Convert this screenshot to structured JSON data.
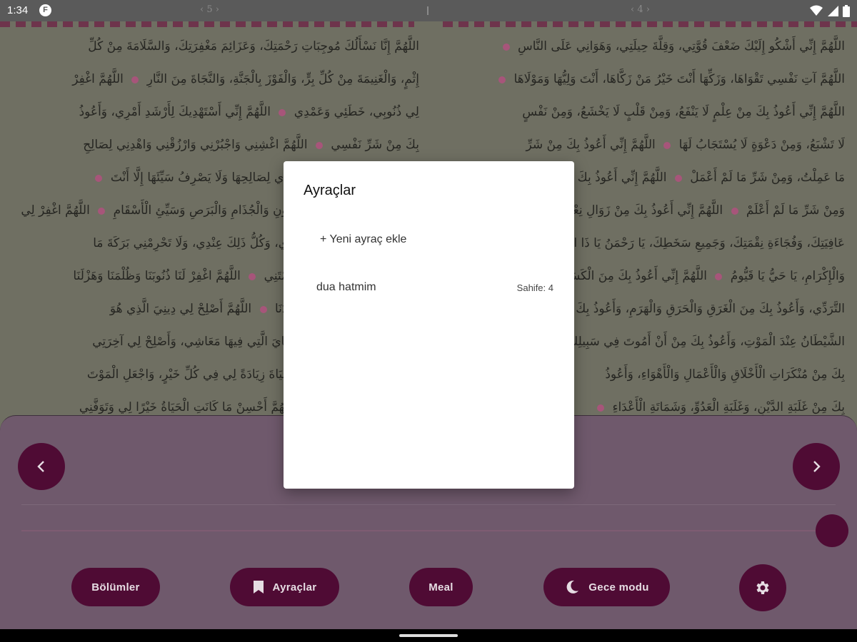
{
  "status_bar": {
    "time": "1:34",
    "app_icon": "F",
    "page_left": "‹ 5 ›",
    "page_right": "‹ 4 ›",
    "icons": [
      "wifi-icon",
      "signal-icon",
      "battery-icon"
    ]
  },
  "pages": {
    "left_lines": [
      "اللَّهُمَّ إِنَّا نَسْأَلُكَ مُوجِبَاتِ رَحْمَتِكَ، وَعَزَائِمَ مَغْفِرَتِكَ، وَالسَّلَامَةَ مِنْ كُلِّ",
      "إِثْمٍ، وَالْغَنِيمَةَ مِنْ كُلِّ بِرٍّ، وَالْفَوْزَ بِالْجَنَّةِ، وَالنَّجَاةَ مِنَ النَّارِ ● اللَّهُمَّ اغْفِرْ",
      "لِي ذُنُوبِي، خَطَئِي وَعَمْدِي ● اللَّهُمَّ إِنِّي أَسْتَهْدِيكَ لِأَرْشَدِ أَمْرِي، وَأَعُوذُ",
      "بِكَ مِنْ شَرِّ نَفْسِي ● اللَّهُمَّ اغْشِنِي وَاجْبُرْنِي وَارْزُقْنِي وَاهْدِنِي لِصَالِحِ",
      "الْأَعْمَالِ وَالْأَخْلَاقِ فَإِنَّهُ لَا يَهْدِي لِصَالِحِهَا وَلَا يَصْرِفُ سَيِّئَهَا إِلَّا أَنْتَ ●",
      "اللَّهُمَّ إِنِّي أَعُوذُ بِكَ مِنَ الْجُنُونِ وَالْجُذَامِ وَالْبَرَصِ وَسَيِّئِ الْأَسْقَامِ ● اللَّهُمَّ اغْفِرْ لِي",
      "هَزْلِي وَجِدِّي وَخَطَئِي وَعَمْدِي، وَكُلُّ ذَلِكَ عِنْدِي، وَلَا تَحْرِمْنِي بَرَكَةَ مَا",
      "أَعْطَيْتَنِي وَلَا تَفْتِنِّي فِيمَا حَرَمْتَنِي ● اللَّهُمَّ اغْفِرْ لَنَا ذُنُوبَنَا وَظُلْمَنَا وَهَزْلَنَا",
      "وَجِدَّنَا وَعَمْدَنَا، وَكُلُّ ذَلِكَ عِنْدَنَا ● اللَّهُمَّ أَصْلِحْ لِي دِينِيَ الَّذِي هُوَ",
      "عِصْمَةُ أَمْرِي، وَأَصْلِحْ لِي دُنْيَايَ الَّتِي فِيهَا مَعَاشِي، وَأَصْلِحْ لِي آخِرَتِي",
      "الَّتِي فِيهَا مَعَادِي، وَاجْعَلِ الْحَيَاةَ زِيَادَةً لِي فِي كُلِّ خَيْرٍ، وَاجْعَلِ الْمَوْتَ",
      "رَاحَةً لِي مِنْ كُلِّ شَرٍّ ● اللَّهُمَّ أَحْسِنْ مَا كَانَتِ الْحَيَاةُ خَيْرًا لِي وَتَوَفَّنِي"
    ],
    "right_lines": [
      "اللَّهُمَّ إِنِّي أَشْكُو إِلَيْكَ ضَعْفَ قُوَّتِي، وَقِلَّةَ حِيلَتِي، وَهَوَانِي عَلَى النَّاسِ ●",
      "اللَّهُمَّ آتِ نَفْسِي تَقْوَاهَا، وَزَكِّهَا أَنْتَ خَيْرُ مَنْ زَكَّاهَا، أَنْتَ وَلِيُّهَا وَمَوْلَاهَا ●",
      "اللَّهُمَّ إِنِّي أَعُوذُ بِكَ مِنْ عِلْمٍ لَا يَنْفَعُ، وَمِنْ قَلْبٍ لَا يَخْشَعُ، وَمِنْ نَفْسٍ",
      "لَا تَشْبَعُ، وَمِنْ دَعْوَةٍ لَا يُسْتَجَابُ لَهَا ● اللَّهُمَّ إِنِّي أَعُوذُ بِكَ مِنْ شَرِّ",
      "مَا عَمِلْتُ، وَمِنْ شَرِّ مَا لَمْ أَعْمَلْ ● اللَّهُمَّ إِنِّي أَعُوذُ بِكَ مِنْ شَرِّ مَا عَمِلْتُ",
      "وَمِنْ شَرِّ مَا لَمْ أَعْلَمْ ● اللَّهُمَّ إِنِّي أَعُوذُ بِكَ مِنْ زَوَالِ نِعْمَتِكَ وَتَحَوُّلِ",
      "عَافِيَتِكَ، وَفُجَاءَةِ نِقْمَتِكَ، وَجَمِيعِ سَخَطِكَ، يَا رَحْمَنُ يَا ذَا الْجَلَالِ",
      "وَالْإِكْرَامِ، يَا حَيُّ يَا قَيُّومُ ● اللَّهُمَّ إِنِّي أَعُوذُ بِكَ مِنَ الْكَسَلِ وَالْهَرَمِ",
      "التَّرَدِّي، وَأَعُوذُ بِكَ مِنَ الْغَرَقِ وَالْحَرَقِ وَالْهَرَمِ، وَأَعُوذُ بِكَ أَنْ يَتَخَبَّطَنِي",
      "الشَّيْطَانُ عِنْدَ الْمَوْتِ، وَأَعُوذُ بِكَ مِنْ أَنْ أَمُوتَ فِي سَبِيلِكَ مُدْبِرًا",
      "بِكَ مِنْ مُنْكَرَاتِ الْأَخْلَاقِ وَالْأَعْمَالِ وَالْأَهْوَاءِ، وَأَعُوذُ",
      "بِكَ مِنْ غَلَبَةِ الدَّيْنِ، وَغَلَبَةِ الْعَدُوِّ، وَشَمَاتَةِ الْأَعْدَاءِ ●"
    ]
  },
  "controls": {
    "sections_label": "Bölümler",
    "bookmarks_label": "Ayraçlar",
    "meal_label": "Meal",
    "night_mode_label": "Gece modu",
    "slider_value": 1.0
  },
  "dialog": {
    "title": "Ayraçlar",
    "add_label": "+ Yeni ayraç ekle",
    "bookmarks": [
      {
        "name": "dua hatmim",
        "page": "Sahife: 4"
      }
    ]
  },
  "colors": {
    "accent": "#4f0b34",
    "panel": "#6f596c",
    "page_bg": "#6f6f62",
    "marker": "#a7557a"
  }
}
